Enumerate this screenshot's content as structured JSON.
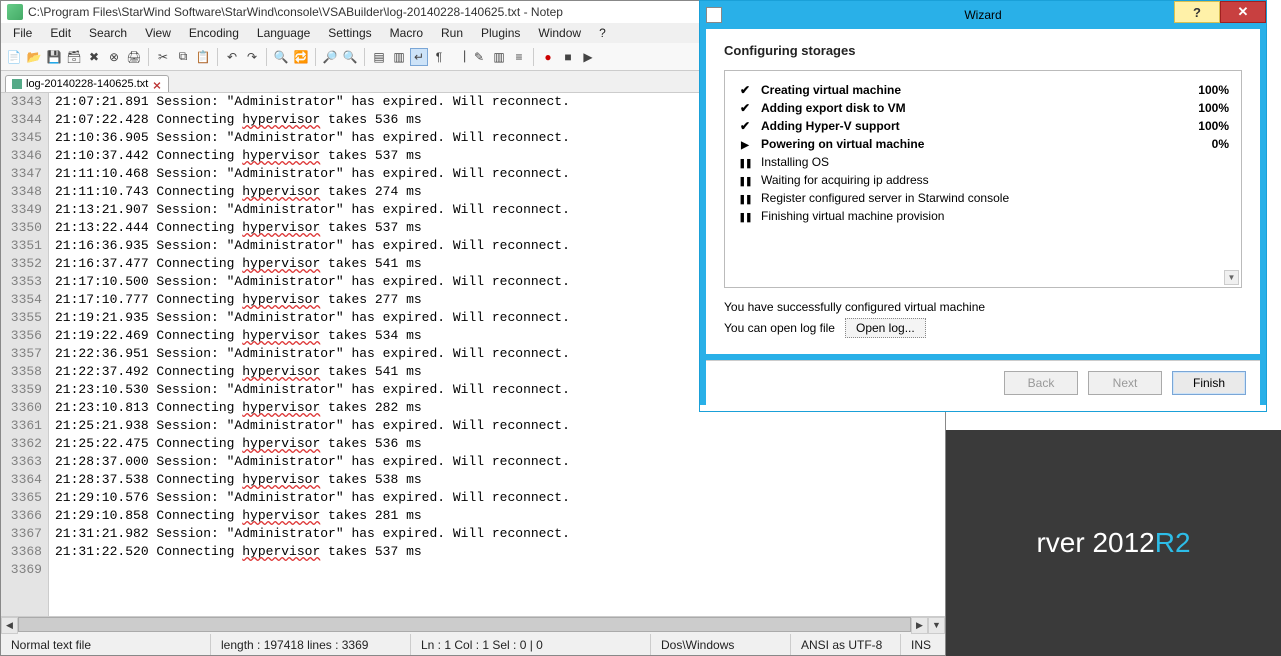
{
  "notepadpp": {
    "title": "C:\\Program Files\\StarWind Software\\StarWind\\console\\VSABuilder\\log-20140228-140625.txt - Notep",
    "menus": [
      "File",
      "Edit",
      "Search",
      "View",
      "Encoding",
      "Language",
      "Settings",
      "Macro",
      "Run",
      "Plugins",
      "Window",
      "?"
    ],
    "tab": {
      "name": "log-20140228-140625.txt"
    },
    "underline_word": "hypervisor",
    "lines": [
      {
        "n": 3343,
        "t": "21:07:21.891 Session: \"Administrator\" has expired. Will reconnect."
      },
      {
        "n": 3344,
        "t": "21:07:22.428 Connecting hypervisor takes 536 ms"
      },
      {
        "n": 3345,
        "t": "21:10:36.905 Session: \"Administrator\" has expired. Will reconnect."
      },
      {
        "n": 3346,
        "t": "21:10:37.442 Connecting hypervisor takes 537 ms"
      },
      {
        "n": 3347,
        "t": "21:11:10.468 Session: \"Administrator\" has expired. Will reconnect."
      },
      {
        "n": 3348,
        "t": "21:11:10.743 Connecting hypervisor takes 274 ms"
      },
      {
        "n": 3349,
        "t": "21:13:21.907 Session: \"Administrator\" has expired. Will reconnect."
      },
      {
        "n": 3350,
        "t": "21:13:22.444 Connecting hypervisor takes 537 ms"
      },
      {
        "n": 3351,
        "t": "21:16:36.935 Session: \"Administrator\" has expired. Will reconnect."
      },
      {
        "n": 3352,
        "t": "21:16:37.477 Connecting hypervisor takes 541 ms"
      },
      {
        "n": 3353,
        "t": "21:17:10.500 Session: \"Administrator\" has expired. Will reconnect."
      },
      {
        "n": 3354,
        "t": "21:17:10.777 Connecting hypervisor takes 277 ms"
      },
      {
        "n": 3355,
        "t": "21:19:21.935 Session: \"Administrator\" has expired. Will reconnect."
      },
      {
        "n": 3356,
        "t": "21:19:22.469 Connecting hypervisor takes 534 ms"
      },
      {
        "n": 3357,
        "t": "21:22:36.951 Session: \"Administrator\" has expired. Will reconnect."
      },
      {
        "n": 3358,
        "t": "21:22:37.492 Connecting hypervisor takes 541 ms"
      },
      {
        "n": 3359,
        "t": "21:23:10.530 Session: \"Administrator\" has expired. Will reconnect."
      },
      {
        "n": 3360,
        "t": "21:23:10.813 Connecting hypervisor takes 282 ms"
      },
      {
        "n": 3361,
        "t": "21:25:21.938 Session: \"Administrator\" has expired. Will reconnect."
      },
      {
        "n": 3362,
        "t": "21:25:22.475 Connecting hypervisor takes 536 ms"
      },
      {
        "n": 3363,
        "t": "21:28:37.000 Session: \"Administrator\" has expired. Will reconnect."
      },
      {
        "n": 3364,
        "t": "21:28:37.538 Connecting hypervisor takes 538 ms"
      },
      {
        "n": 3365,
        "t": "21:29:10.576 Session: \"Administrator\" has expired. Will reconnect."
      },
      {
        "n": 3366,
        "t": "21:29:10.858 Connecting hypervisor takes 281 ms"
      },
      {
        "n": 3367,
        "t": "21:31:21.982 Session: \"Administrator\" has expired. Will reconnect."
      },
      {
        "n": 3368,
        "t": "21:31:22.520 Connecting hypervisor takes 537 ms"
      },
      {
        "n": 3369,
        "t": ""
      }
    ],
    "status": {
      "filetype": "Normal text file",
      "length_lines": "length : 197418     lines : 3369",
      "pos": "Ln : 1    Col : 1    Sel : 0 | 0",
      "eol": "Dos\\Windows",
      "encoding": "ANSI as UTF-8",
      "mode": "INS"
    }
  },
  "wizard": {
    "title": "Wizard",
    "heading": "Configuring storages",
    "steps": [
      {
        "state": "completed",
        "label": "Creating virtual machine",
        "pct": "100%",
        "bold": true
      },
      {
        "state": "completed",
        "label": "Adding export disk to VM",
        "pct": "100%",
        "bold": true
      },
      {
        "state": "completed",
        "label": "Adding Hyper-V support",
        "pct": "100%",
        "bold": true
      },
      {
        "state": "active",
        "label": "Powering on virtual machine",
        "pct": "0%",
        "bold": true
      },
      {
        "state": "pending",
        "label": "Installing OS",
        "pct": "",
        "bold": false
      },
      {
        "state": "pending",
        "label": "Waiting for acquiring ip address",
        "pct": "",
        "bold": false
      },
      {
        "state": "pending",
        "label": "Register configured server in Starwind console",
        "pct": "",
        "bold": false
      },
      {
        "state": "pending",
        "label": "Finishing virtual machine provision",
        "pct": "",
        "bold": false
      }
    ],
    "msg1": "You have successfully configured virtual machine",
    "msg2": "You can open log file",
    "open_log": "Open log...",
    "btn_back": "Back",
    "btn_next": "Next",
    "btn_finish": "Finish"
  },
  "desktop": {
    "text_pre": "rver 2012 ",
    "text_accent": "R2"
  }
}
